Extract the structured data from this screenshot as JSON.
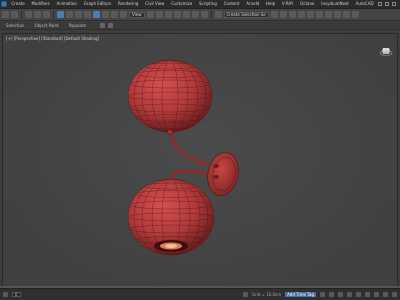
{
  "menubar": {
    "items": [
      "Create",
      "Modifiers",
      "Animation",
      "Graph Editors",
      "Rendering",
      "Civil View",
      "Customize",
      "Scripting",
      "Content",
      "Arnold",
      "Help",
      "V-RAY",
      "Octane",
      "InsydiumNext",
      "AutoCAD"
    ]
  },
  "toolbar": {
    "view_dropdown": "View",
    "selection_dropdown": "Create Selection Se"
  },
  "ribbon": {
    "tabs": [
      "Selection",
      "Object Paint",
      "Populate"
    ]
  },
  "viewport": {
    "label": "[+] [Perspective] [Standard] [Default Shading]",
    "object_color": "#b03a3a"
  },
  "status": {
    "grid_text": "Grid = 10.0cm",
    "key_button": "Add Time Tag",
    "frame_field": "0"
  },
  "colors": {
    "accent": "#4a7fb5",
    "background": "#3d3d3d"
  }
}
